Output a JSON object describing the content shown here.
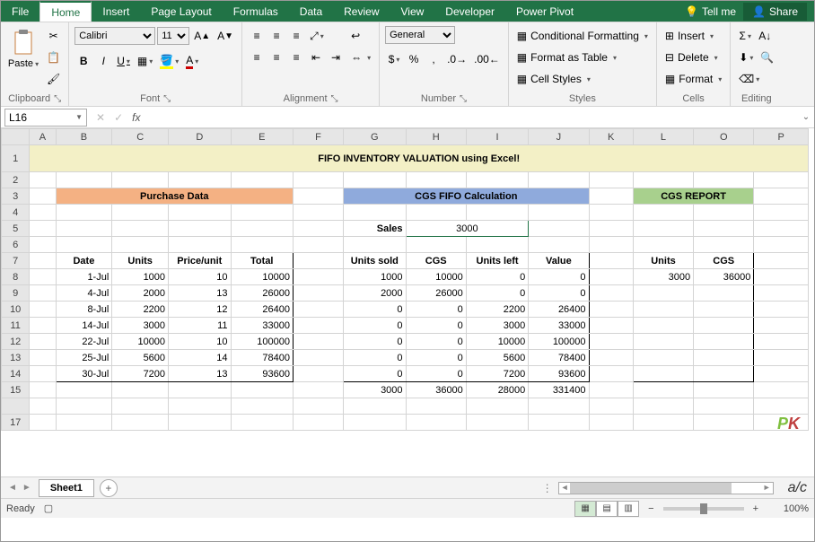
{
  "tabs": {
    "file": "File",
    "home": "Home",
    "insert": "Insert",
    "pagelayout": "Page Layout",
    "formulas": "Formulas",
    "data": "Data",
    "review": "Review",
    "view": "View",
    "developer": "Developer",
    "powerpivot": "Power Pivot",
    "tellme": "Tell me",
    "share": "Share"
  },
  "ribbon": {
    "clipboard": {
      "paste": "Paste",
      "label": "Clipboard"
    },
    "font": {
      "name": "Calibri",
      "size": "11",
      "label": "Font",
      "bold": "B",
      "italic": "I",
      "underline": "U"
    },
    "alignment": {
      "label": "Alignment",
      "wrap": "Wrap Text",
      "merge": "Merge & Center"
    },
    "number": {
      "label": "Number",
      "format": "General",
      "currency": "$",
      "percent": "%",
      "comma": ","
    },
    "styles": {
      "label": "Styles",
      "cond": "Conditional Formatting",
      "table": "Format as Table",
      "cell": "Cell Styles"
    },
    "cells": {
      "label": "Cells",
      "insert": "Insert",
      "delete": "Delete",
      "format": "Format"
    },
    "editing": {
      "label": "Editing"
    }
  },
  "namebox": "L16",
  "fx": "",
  "cols": [
    "A",
    "B",
    "C",
    "D",
    "E",
    "F",
    "G",
    "H",
    "I",
    "J",
    "K",
    "L",
    "O",
    "P"
  ],
  "title": "FIFO INVENTORY VALUATION using Excel!",
  "headers": {
    "purchase": "Purchase Data",
    "cgs": "CGS FIFO Calculation",
    "report": "CGS REPORT"
  },
  "sales_label": "Sales",
  "sales_value": "3000",
  "colhdr": {
    "date": "Date",
    "units": "Units",
    "price": "Price/unit",
    "total": "Total",
    "sold": "Units sold",
    "cgs": "CGS",
    "left": "Units left",
    "value": "Value",
    "runits": "Units",
    "rcgs": "CGS"
  },
  "rows": [
    {
      "date": "1-Jul",
      "units": "1000",
      "price": "10",
      "total": "10000",
      "sold": "1000",
      "cgs": "10000",
      "left": "0",
      "value": "0"
    },
    {
      "date": "4-Jul",
      "units": "2000",
      "price": "13",
      "total": "26000",
      "sold": "2000",
      "cgs": "26000",
      "left": "0",
      "value": "0"
    },
    {
      "date": "8-Jul",
      "units": "2200",
      "price": "12",
      "total": "26400",
      "sold": "0",
      "cgs": "0",
      "left": "2200",
      "value": "26400"
    },
    {
      "date": "14-Jul",
      "units": "3000",
      "price": "11",
      "total": "33000",
      "sold": "0",
      "cgs": "0",
      "left": "3000",
      "value": "33000"
    },
    {
      "date": "22-Jul",
      "units": "10000",
      "price": "10",
      "total": "100000",
      "sold": "0",
      "cgs": "0",
      "left": "10000",
      "value": "100000"
    },
    {
      "date": "25-Jul",
      "units": "5600",
      "price": "14",
      "total": "78400",
      "sold": "0",
      "cgs": "0",
      "left": "5600",
      "value": "78400"
    },
    {
      "date": "30-Jul",
      "units": "7200",
      "price": "13",
      "total": "93600",
      "sold": "0",
      "cgs": "0",
      "left": "7200",
      "value": "93600"
    }
  ],
  "totals": {
    "sold": "3000",
    "cgs": "36000",
    "left": "28000",
    "value": "331400"
  },
  "report": {
    "units": "3000",
    "cgs": "36000"
  },
  "sheet": {
    "name": "Sheet1"
  },
  "status": {
    "ready": "Ready",
    "zoom": "100%"
  }
}
